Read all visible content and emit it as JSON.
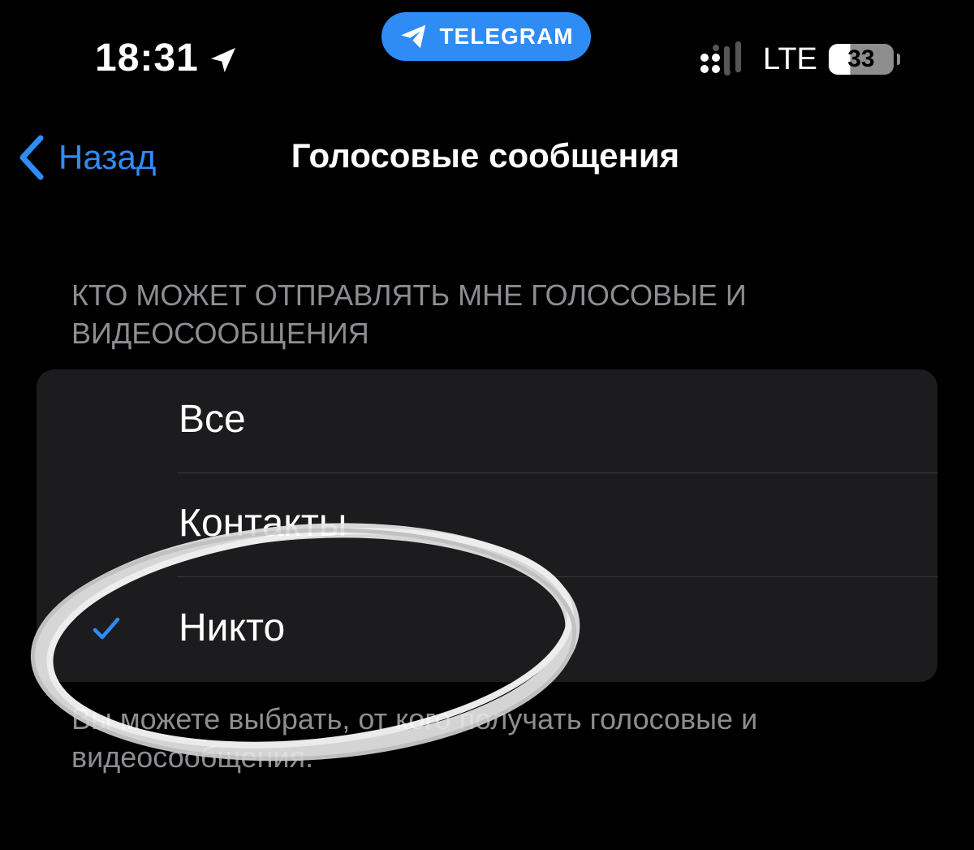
{
  "status_bar": {
    "time": "18:31",
    "app_pill": "TELEGRAM",
    "network": "LTE",
    "battery": "33",
    "icons": [
      "location-arrow-icon",
      "telegram-plane-icon",
      "signal-icon"
    ]
  },
  "nav": {
    "back_label": "Назад",
    "title": "Голосовые сообщения",
    "accent": "#2f8cf5"
  },
  "section": {
    "header": "КТО МОЖЕТ ОТПРАВЛЯТЬ МНЕ ГОЛОСОВЫЕ И ВИДЕОСООБЩЕНИЯ",
    "options": [
      {
        "label": "Все",
        "selected": false
      },
      {
        "label": "Контакты",
        "selected": false
      },
      {
        "label": "Никто",
        "selected": true
      }
    ],
    "footer": "Вы можете выбрать, от кого получать голосовые и видеосообщения."
  }
}
